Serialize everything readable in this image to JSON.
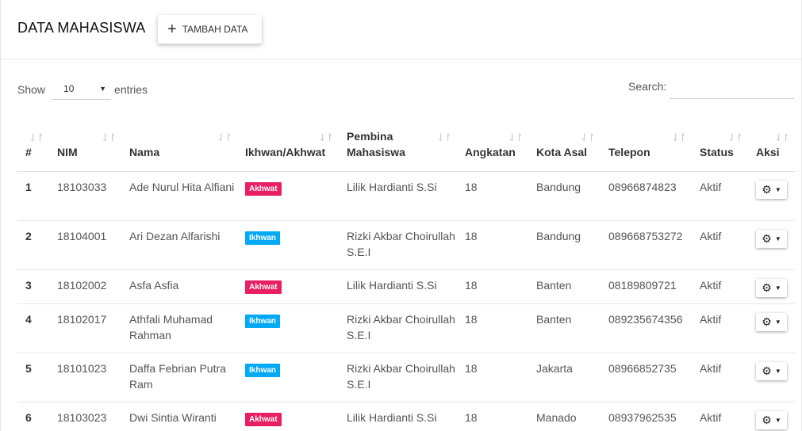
{
  "header": {
    "title": "DATA MAHASISWA",
    "add_button": "TAMBAH DATA",
    "add_icon": "plus-icon"
  },
  "controls": {
    "show_label": "Show",
    "entries_value": "10",
    "entries_label": "entries",
    "search_label": "Search:",
    "search_value": ""
  },
  "table": {
    "columns": [
      "#",
      "NIM",
      "Nama",
      "Ikhwan/Akhwat",
      "Pembina Mahasiswa",
      "Angkatan",
      "Kota Asal",
      "Telepon",
      "Status",
      "Aksi"
    ],
    "rows": [
      {
        "no": "1",
        "nim": "18103033",
        "nama": "Ade Nurul Hita Alfiani",
        "gender": "Akhwat",
        "pembina": "Lilik Hardianti S.Si",
        "angkatan": "18",
        "kota": "Bandung",
        "telepon": "08966874823",
        "status": "Aktif"
      },
      {
        "no": "2",
        "nim": "18104001",
        "nama": "Ari Dezan Alfarishi",
        "gender": "Ikhwan",
        "pembina": "Rizki Akbar Choirullah S.E.I",
        "angkatan": "18",
        "kota": "Bandung",
        "telepon": "089668753272",
        "status": "Aktif"
      },
      {
        "no": "3",
        "nim": "18102002",
        "nama": "Asfa Asfia",
        "gender": "Akhwat",
        "pembina": "Lilik Hardianti S.Si",
        "angkatan": "18",
        "kota": "Banten",
        "telepon": "08189809721",
        "status": "Aktif"
      },
      {
        "no": "4",
        "nim": "18102017",
        "nama": "Athfali Muhamad Rahman",
        "gender": "Ikhwan",
        "pembina": "Rizki Akbar Choirullah S.E.I",
        "angkatan": "18",
        "kota": "Banten",
        "telepon": "089235674356",
        "status": "Aktif"
      },
      {
        "no": "5",
        "nim": "18101023",
        "nama": "Daffa Febrian Putra Ram",
        "gender": "Ikhwan",
        "pembina": "Rizki Akbar Choirullah S.E.I",
        "angkatan": "18",
        "kota": "Jakarta",
        "telepon": "08966852735",
        "status": "Aktif"
      },
      {
        "no": "6",
        "nim": "18103023",
        "nama": "Dwi Sintia Wiranti",
        "gender": "Akhwat",
        "pembina": "Lilik Hardianti S.Si",
        "angkatan": "18",
        "kota": "Manado",
        "telepon": "08937962535",
        "status": "Aktif"
      }
    ]
  },
  "colors": {
    "akhwat": "#e91e63",
    "ikhwan": "#03a9f4"
  }
}
